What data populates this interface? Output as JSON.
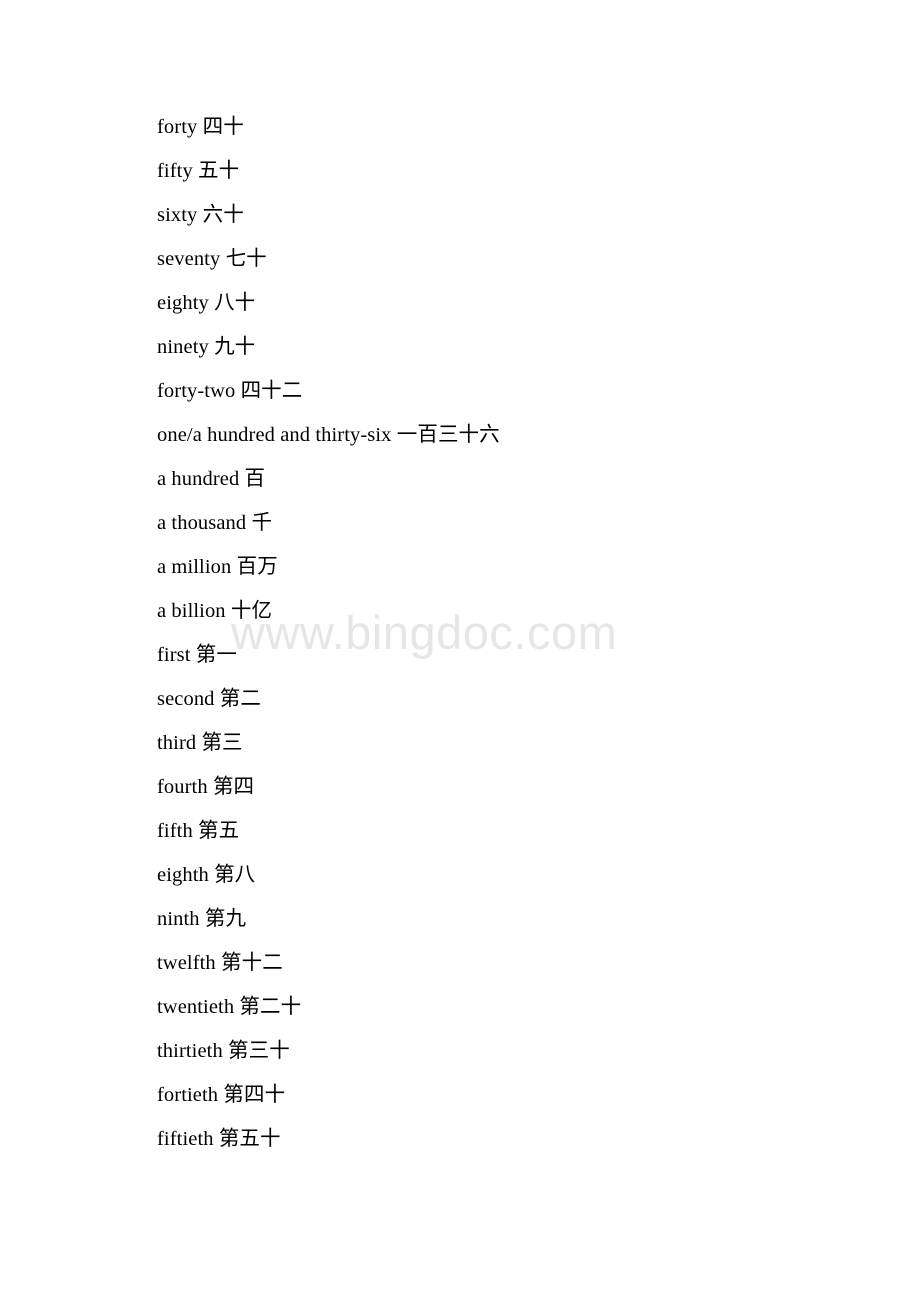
{
  "document": {
    "background_color": "#ffffff",
    "text_color": "#000000",
    "watermark": {
      "text": "www.bingdoc.com",
      "color": "#e6e6e6"
    },
    "lines": [
      {
        "english": "forty",
        "chinese": "四十"
      },
      {
        "english": "fifty",
        "chinese": "五十"
      },
      {
        "english": "sixty",
        "chinese": "六十"
      },
      {
        "english": "seventy",
        "chinese": "七十"
      },
      {
        "english": "eighty",
        "chinese": "八十"
      },
      {
        "english": "ninety",
        "chinese": "九十"
      },
      {
        "english": "forty-two",
        "chinese": "四十二"
      },
      {
        "english": "one/a hundred and thirty-six",
        "chinese": "一百三十六"
      },
      {
        "english": "a hundred",
        "chinese": "百"
      },
      {
        "english": "a thousand",
        "chinese": "千"
      },
      {
        "english": "a million",
        "chinese": "百万"
      },
      {
        "english": "a billion",
        "chinese": "十亿"
      },
      {
        "english": "first",
        "chinese": "第一"
      },
      {
        "english": "second",
        "chinese": "第二"
      },
      {
        "english": "third",
        "chinese": "第三"
      },
      {
        "english": "fourth",
        "chinese": "第四"
      },
      {
        "english": "fifth",
        "chinese": "第五"
      },
      {
        "english": "eighth",
        "chinese": "第八"
      },
      {
        "english": "ninth",
        "chinese": "第九"
      },
      {
        "english": "twelfth",
        "chinese": "第十二"
      },
      {
        "english": "twentieth",
        "chinese": "第二十"
      },
      {
        "english": "thirtieth",
        "chinese": "第三十"
      },
      {
        "english": "fortieth",
        "chinese": "第四十"
      },
      {
        "english": "fiftieth",
        "chinese": "第五十"
      }
    ]
  }
}
